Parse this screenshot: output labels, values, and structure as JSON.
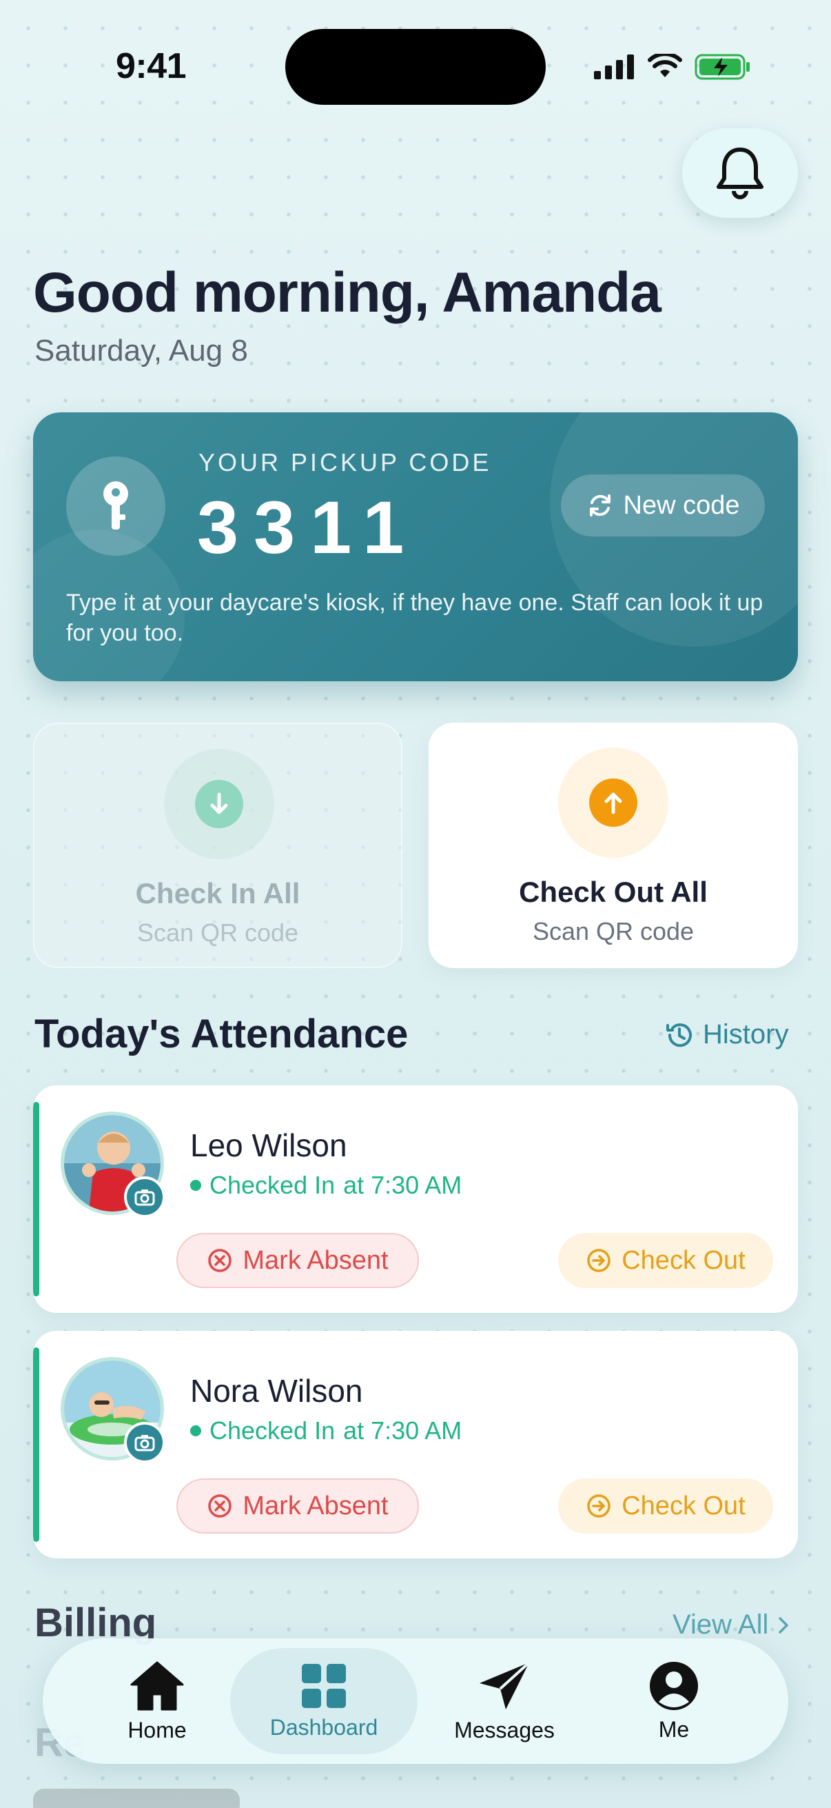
{
  "status_bar": {
    "time": "9:41"
  },
  "header": {
    "greeting": "Good morning, Amanda",
    "date": "Saturday, Aug 8"
  },
  "pickup": {
    "label": "YOUR PICKUP CODE",
    "code": "3311",
    "new_code_label": "New code",
    "note": "Type it at your daycare's kiosk, if they have one. Staff can look it up for you too."
  },
  "actions": {
    "check_in": {
      "title": "Check In All",
      "subtitle": "Scan QR code"
    },
    "check_out": {
      "title": "Check Out All",
      "subtitle": "Scan QR code"
    }
  },
  "attendance": {
    "title": "Today's Attendance",
    "history_label": "History",
    "children": [
      {
        "name": "Leo Wilson",
        "status": "Checked In",
        "time": "at 7:30 AM",
        "absent_label": "Mark Absent",
        "checkout_label": "Check Out"
      },
      {
        "name": "Nora Wilson",
        "status": "Checked In",
        "time": "at 7:30 AM",
        "absent_label": "Mark Absent",
        "checkout_label": "Check Out"
      }
    ]
  },
  "billing": {
    "title": "Billing",
    "view_all_label": "View All"
  },
  "recent": {
    "title": "Re"
  },
  "tabbar": {
    "items": [
      {
        "label": "Home",
        "icon": "home-icon"
      },
      {
        "label": "Dashboard",
        "icon": "dashboard-icon",
        "active": true
      },
      {
        "label": "Messages",
        "icon": "paper-plane-icon"
      },
      {
        "label": "Me",
        "icon": "user-circle-icon"
      }
    ]
  },
  "colors": {
    "accent": "#2f8898",
    "pickup_card": "#3a8a97",
    "checked_in": "#20b582",
    "absent": "#dd4a4a",
    "checkout": "#e5a01a"
  }
}
